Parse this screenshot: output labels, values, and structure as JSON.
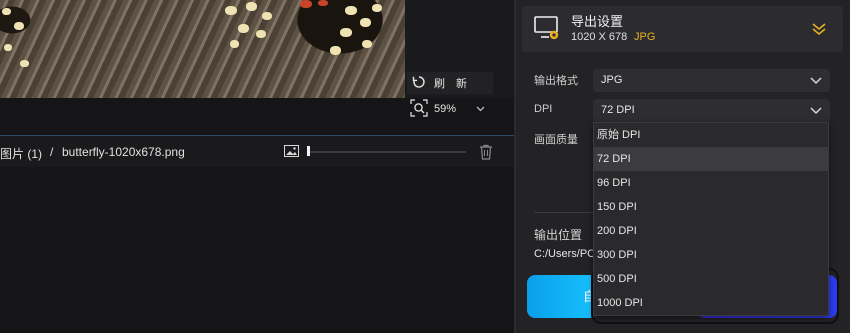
{
  "preview": {
    "refresh_label": "刷 新",
    "zoom_value": "59%"
  },
  "file_bar": {
    "crumb": "图片 (1)",
    "separator": "/",
    "filename": "butterfly-1020x678.png"
  },
  "export_panel": {
    "header": {
      "title": "导出设置",
      "size": "1020 X 678",
      "format": "JPG"
    },
    "format_label": "输出格式",
    "format_value": "JPG",
    "dpi_label": "DPI",
    "dpi_value": "72 DPI",
    "quality_label": "画面质量",
    "output_title": "输出位置",
    "output_path": "C:/Users/PC",
    "export_label": "自"
  },
  "dpi_options": [
    "原始 DPI",
    "72 DPI",
    "96 DPI",
    "150 DPI",
    "200 DPI",
    "300 DPI",
    "500 DPI",
    "1000 DPI"
  ],
  "dpi_selected_index": 1,
  "colors": {
    "accent_gold": "#e8b020",
    "accent_blue": "#17c2ff",
    "accent_purple": "#3a2bd8"
  }
}
